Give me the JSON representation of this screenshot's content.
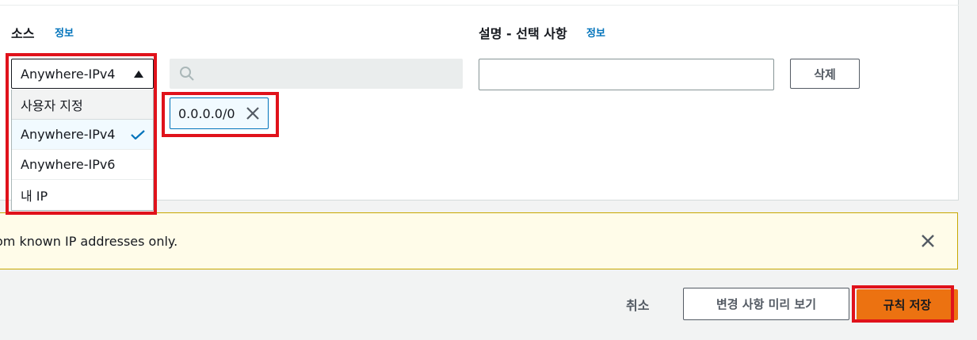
{
  "source": {
    "label": "소스",
    "info": "정보",
    "selected": "Anywhere-IPv4",
    "options": [
      {
        "label": "사용자 지정",
        "selected": false
      },
      {
        "label": "Anywhere-IPv4",
        "selected": true
      },
      {
        "label": "Anywhere-IPv6",
        "selected": false
      },
      {
        "label": "내 IP",
        "selected": false
      }
    ],
    "token": "0.0.0.0/0"
  },
  "description": {
    "label": "설명 - 선택 사항",
    "info": "정보",
    "value": ""
  },
  "delete_label": "삭제",
  "warning": {
    "text": "om known IP addresses only."
  },
  "footer": {
    "cancel": "취소",
    "preview": "변경 사항 미리 보기",
    "save": "규칙 저장"
  },
  "colors": {
    "accent": "#0073bb",
    "primary_button": "#ec7211",
    "highlight_box": "#e0121b",
    "warning_bg": "#fffce9",
    "warning_border": "#c7a800"
  }
}
